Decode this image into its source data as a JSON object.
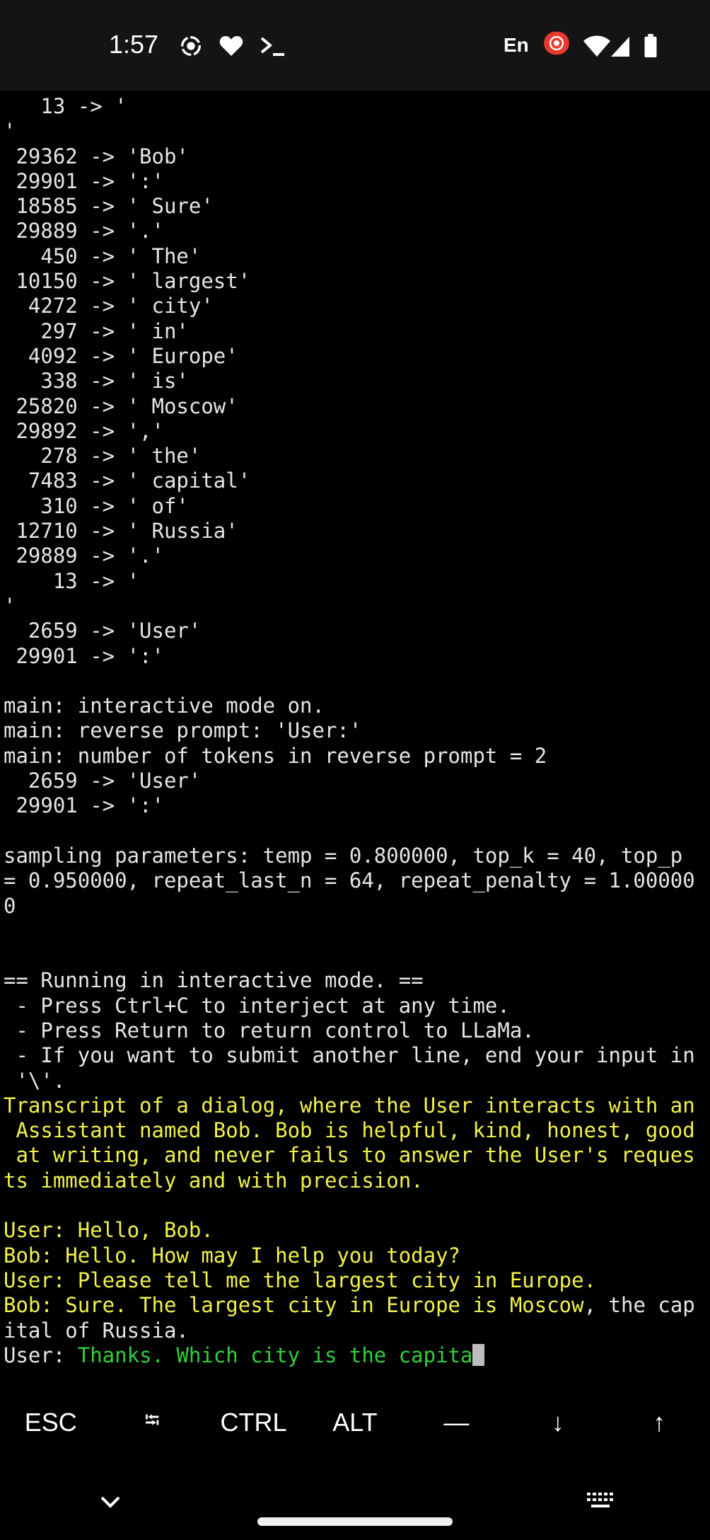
{
  "status_bar": {
    "time": "1:57",
    "lang": "En",
    "icons": [
      "screen-record-icon",
      "heart-icon",
      "terminal-prompt-icon",
      "cast-record-icon",
      "wifi-icon",
      "signal-icon",
      "battery-icon"
    ]
  },
  "colors": {
    "background": "#000000",
    "text": "#e6e6e6",
    "prompt_yellow": "#f2f24a",
    "input_green": "#2fd13c",
    "record_red": "#e8392f"
  },
  "terminal": {
    "lines": [
      {
        "segments": [
          {
            "text": "   13 -> '",
            "style": "default"
          }
        ]
      },
      {
        "segments": [
          {
            "text": "'",
            "style": "default"
          }
        ]
      },
      {
        "segments": [
          {
            "text": " 29362 -> 'Bob'",
            "style": "default"
          }
        ]
      },
      {
        "segments": [
          {
            "text": " 29901 -> ':'",
            "style": "default"
          }
        ]
      },
      {
        "segments": [
          {
            "text": " 18585 -> ' Sure'",
            "style": "default"
          }
        ]
      },
      {
        "segments": [
          {
            "text": " 29889 -> '.'",
            "style": "default"
          }
        ]
      },
      {
        "segments": [
          {
            "text": "   450 -> ' The'",
            "style": "default"
          }
        ]
      },
      {
        "segments": [
          {
            "text": " 10150 -> ' largest'",
            "style": "default"
          }
        ]
      },
      {
        "segments": [
          {
            "text": "  4272 -> ' city'",
            "style": "default"
          }
        ]
      },
      {
        "segments": [
          {
            "text": "   297 -> ' in'",
            "style": "default"
          }
        ]
      },
      {
        "segments": [
          {
            "text": "  4092 -> ' Europe'",
            "style": "default"
          }
        ]
      },
      {
        "segments": [
          {
            "text": "   338 -> ' is'",
            "style": "default"
          }
        ]
      },
      {
        "segments": [
          {
            "text": " 25820 -> ' Moscow'",
            "style": "default"
          }
        ]
      },
      {
        "segments": [
          {
            "text": " 29892 -> ','",
            "style": "default"
          }
        ]
      },
      {
        "segments": [
          {
            "text": "   278 -> ' the'",
            "style": "default"
          }
        ]
      },
      {
        "segments": [
          {
            "text": "  7483 -> ' capital'",
            "style": "default"
          }
        ]
      },
      {
        "segments": [
          {
            "text": "   310 -> ' of'",
            "style": "default"
          }
        ]
      },
      {
        "segments": [
          {
            "text": " 12710 -> ' Russia'",
            "style": "default"
          }
        ]
      },
      {
        "segments": [
          {
            "text": " 29889 -> '.'",
            "style": "default"
          }
        ]
      },
      {
        "segments": [
          {
            "text": "    13 -> '",
            "style": "default"
          }
        ]
      },
      {
        "segments": [
          {
            "text": "'",
            "style": "default"
          }
        ]
      },
      {
        "segments": [
          {
            "text": "  2659 -> 'User'",
            "style": "default"
          }
        ]
      },
      {
        "segments": [
          {
            "text": " 29901 -> ':'",
            "style": "default"
          }
        ]
      },
      {
        "segments": [
          {
            "text": "",
            "style": "default"
          }
        ]
      },
      {
        "segments": [
          {
            "text": "main: interactive mode on.",
            "style": "default"
          }
        ]
      },
      {
        "segments": [
          {
            "text": "main: reverse prompt: 'User:'",
            "style": "default"
          }
        ]
      },
      {
        "segments": [
          {
            "text": "main: number of tokens in reverse prompt = 2",
            "style": "default"
          }
        ]
      },
      {
        "segments": [
          {
            "text": "  2659 -> 'User'",
            "style": "default"
          }
        ]
      },
      {
        "segments": [
          {
            "text": " 29901 -> ':'",
            "style": "default"
          }
        ]
      },
      {
        "segments": [
          {
            "text": "",
            "style": "default"
          }
        ]
      },
      {
        "segments": [
          {
            "text": "sampling parameters: temp = 0.800000, top_k = 40, top_p",
            "style": "default"
          }
        ]
      },
      {
        "segments": [
          {
            "text": "= 0.950000, repeat_last_n = 64, repeat_penalty = 1.00000",
            "style": "default"
          }
        ]
      },
      {
        "segments": [
          {
            "text": "0",
            "style": "default"
          }
        ]
      },
      {
        "segments": [
          {
            "text": "",
            "style": "default"
          }
        ]
      },
      {
        "segments": [
          {
            "text": "",
            "style": "default"
          }
        ]
      },
      {
        "segments": [
          {
            "text": "== Running in interactive mode. ==",
            "style": "default"
          }
        ]
      },
      {
        "segments": [
          {
            "text": " - Press Ctrl+C to interject at any time.",
            "style": "default"
          }
        ]
      },
      {
        "segments": [
          {
            "text": " - Press Return to return control to LLaMa.",
            "style": "default"
          }
        ]
      },
      {
        "segments": [
          {
            "text": " - If you want to submit another line, end your input in",
            "style": "default"
          }
        ]
      },
      {
        "segments": [
          {
            "text": " '\\'.",
            "style": "default"
          }
        ]
      },
      {
        "segments": [
          {
            "text": "Transcript of a dialog, where the User interacts with an",
            "style": "yellow"
          }
        ]
      },
      {
        "segments": [
          {
            "text": " Assistant named Bob. Bob is helpful, kind, honest, good",
            "style": "yellow"
          }
        ]
      },
      {
        "segments": [
          {
            "text": " at writing, and never fails to answer the User's reques",
            "style": "yellow"
          }
        ]
      },
      {
        "segments": [
          {
            "text": "ts immediately and with precision.",
            "style": "yellow"
          }
        ]
      },
      {
        "segments": [
          {
            "text": "",
            "style": "yellow"
          }
        ]
      },
      {
        "segments": [
          {
            "text": "User: Hello, Bob.",
            "style": "yellow"
          }
        ]
      },
      {
        "segments": [
          {
            "text": "Bob: Hello. How may I help you today?",
            "style": "yellow"
          }
        ]
      },
      {
        "segments": [
          {
            "text": "User: Please tell me the largest city in Europe.",
            "style": "yellow"
          }
        ]
      },
      {
        "segments": [
          {
            "text": "Bob: Sure. The largest city in Europe is Moscow",
            "style": "yellow"
          },
          {
            "text": ", the cap",
            "style": "default"
          }
        ]
      },
      {
        "segments": [
          {
            "text": "ital of Russia.",
            "style": "default"
          }
        ]
      },
      {
        "segments": [
          {
            "text": "User: ",
            "style": "default"
          },
          {
            "text": "Thanks. Which city is the capita",
            "style": "green"
          }
        ],
        "cursor": true
      }
    ]
  },
  "extra_keys": [
    {
      "name": "esc-key",
      "label": "ESC",
      "size": "normal"
    },
    {
      "name": "tab-key",
      "label": "⭾",
      "size": "small"
    },
    {
      "name": "ctrl-key",
      "label": "CTRL",
      "size": "normal"
    },
    {
      "name": "alt-key",
      "label": "ALT",
      "size": "normal"
    },
    {
      "name": "dash-key",
      "label": "—",
      "size": "normal"
    },
    {
      "name": "arrow-down-key",
      "label": "↓",
      "size": "normal"
    },
    {
      "name": "arrow-up-key",
      "label": "↑",
      "size": "normal"
    }
  ],
  "nav_bar": {
    "icons": [
      "chevron-down-icon",
      "keyboard-icon"
    ]
  }
}
